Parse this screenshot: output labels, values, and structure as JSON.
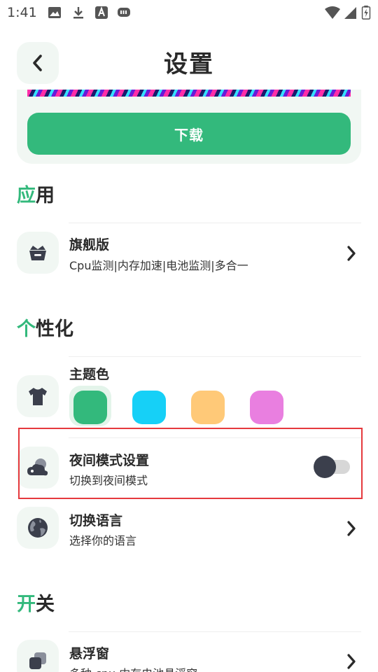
{
  "status_bar": {
    "time": "1:41",
    "left_icons": [
      "image-icon",
      "download-icon",
      "a-letter-icon",
      "gamepad-icon"
    ],
    "right_icons": [
      "wifi-icon",
      "signal-icon",
      "battery-icon"
    ]
  },
  "header": {
    "title": "设置",
    "back_icon": "chevron-left-icon"
  },
  "banner": {
    "download_label": "下载"
  },
  "sections": {
    "app": {
      "accent": "应",
      "rest": "用"
    },
    "personalize": {
      "accent": "个",
      "rest": "性化"
    },
    "switch": {
      "accent": "开",
      "rest": "关"
    }
  },
  "rows": {
    "flagship": {
      "title": "旗舰版",
      "subtitle": "Cpu监测|内存加速|电池监测|多合一",
      "icon": "basket-icon"
    },
    "theme": {
      "title": "主题色",
      "icon": "tshirt-icon"
    },
    "night": {
      "title": "夜间模式设置",
      "subtitle": "切换到夜间模式",
      "icon": "cloud-moon-icon",
      "enabled": false
    },
    "language": {
      "title": "切换语言",
      "subtitle": "选择你的语言",
      "icon": "globe-icon"
    },
    "floating": {
      "title": "悬浮窗",
      "subtitle": "多种 cpu 内存电池悬浮窗",
      "icon": "layers-icon"
    }
  },
  "theme_colors": [
    {
      "name": "green",
      "hex": "#33b97c",
      "selected": true
    },
    {
      "name": "cyan",
      "hex": "#16d0f7",
      "selected": false
    },
    {
      "name": "orange",
      "hex": "#ffc978",
      "selected": false
    },
    {
      "name": "pink",
      "hex": "#e97fe0",
      "selected": false
    }
  ],
  "colors": {
    "accent": "#33b97c",
    "highlight": "#e5393d",
    "icon_dark": "#3b3f4c",
    "card_bg": "#f1f7f3"
  }
}
